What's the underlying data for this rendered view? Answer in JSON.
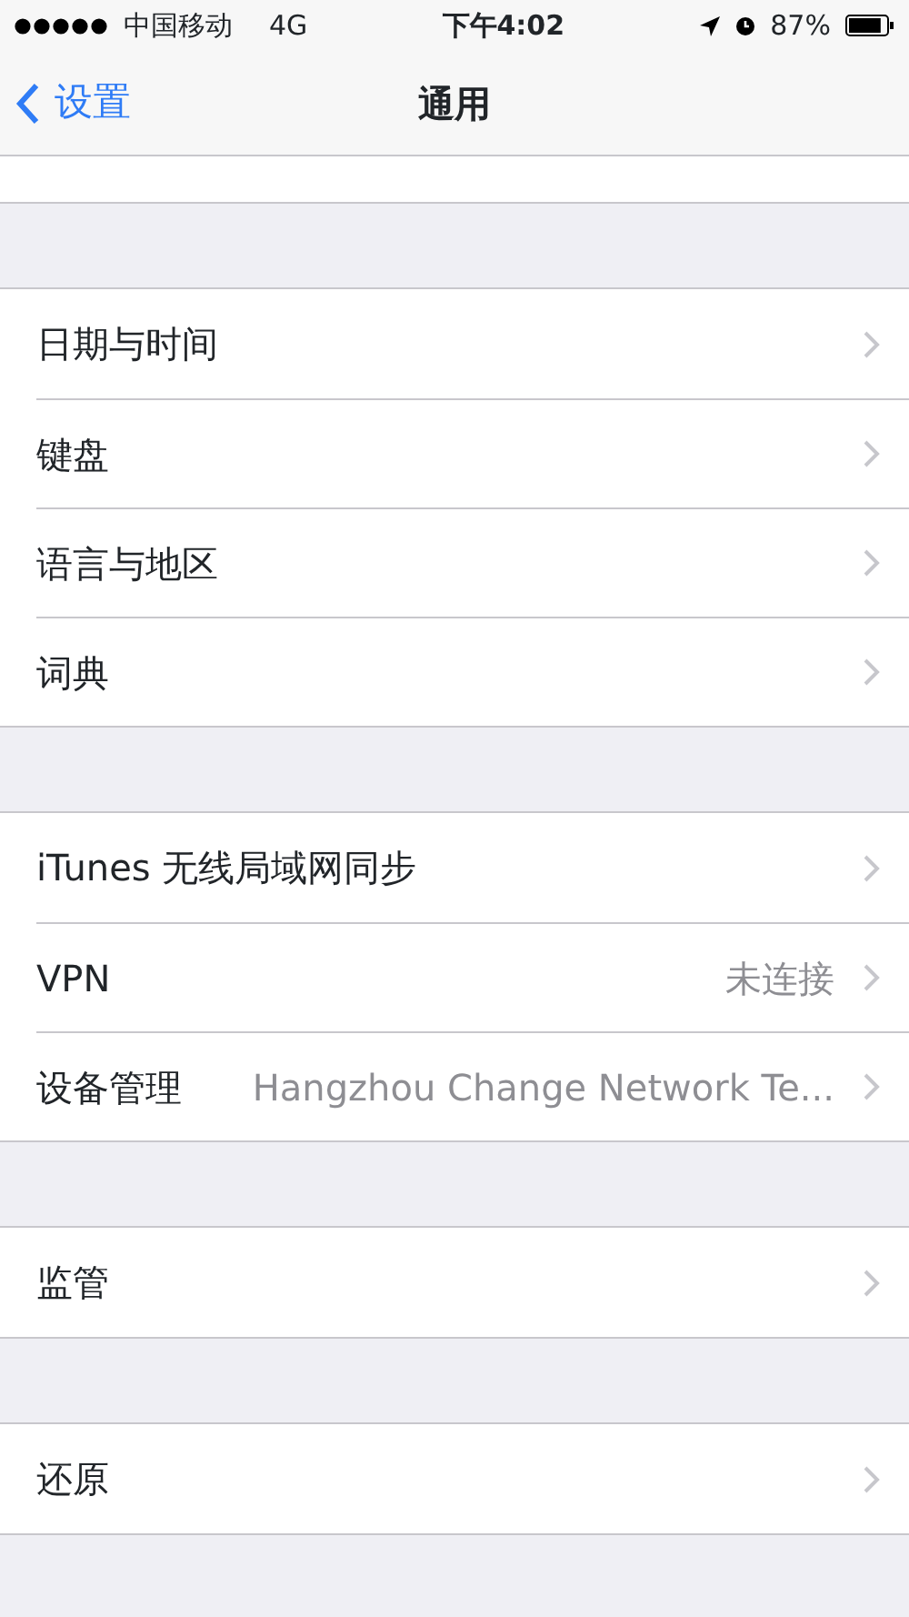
{
  "status_bar": {
    "carrier": "中国移动",
    "network": "4G",
    "time": "下午4:02",
    "battery": "87%"
  },
  "nav_bar": {
    "back": "设置",
    "title": "通用"
  },
  "sections": [
    {
      "rows": [
        {
          "label": "日期与时间"
        },
        {
          "label": "键盘"
        },
        {
          "label": "语言与地区"
        },
        {
          "label": "词典"
        }
      ]
    },
    {
      "rows": [
        {
          "label": "iTunes 无线局域网同步"
        },
        {
          "label": "VPN",
          "value": "未连接"
        },
        {
          "label": "设备管理",
          "value": "Hangzhou Change Network Te..."
        }
      ]
    },
    {
      "rows": [
        {
          "label": "监管"
        }
      ]
    },
    {
      "rows": [
        {
          "label": "还原"
        }
      ]
    }
  ]
}
